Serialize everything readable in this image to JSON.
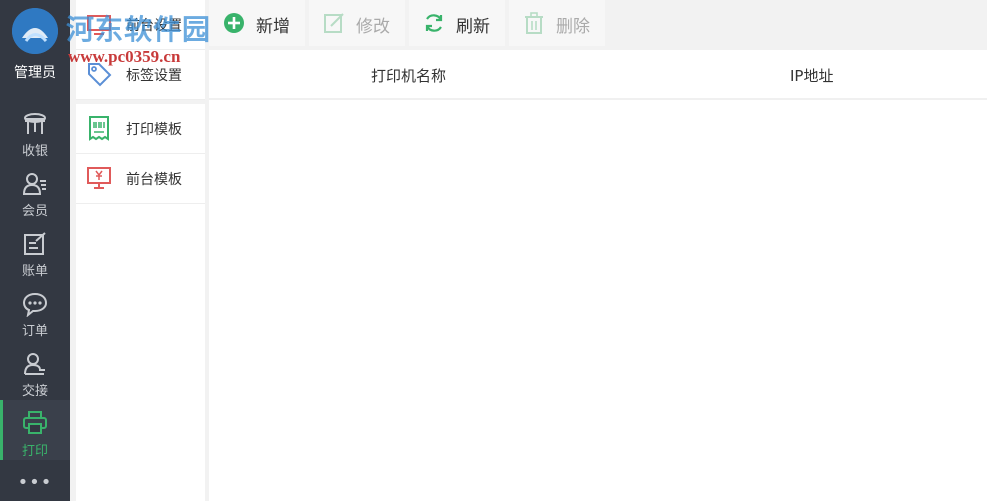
{
  "watermark": {
    "site_name": "河东软件园",
    "url": "www.pc0359.cn"
  },
  "user": {
    "label": "管理员"
  },
  "nav": {
    "items": [
      {
        "id": "cashier",
        "label": "收银",
        "icon": "stool-icon"
      },
      {
        "id": "member",
        "label": "会员",
        "icon": "member-icon"
      },
      {
        "id": "bill",
        "label": "账单",
        "icon": "edit-note-icon"
      },
      {
        "id": "order",
        "label": "订单",
        "icon": "chat-bubble-icon"
      },
      {
        "id": "handover",
        "label": "交接",
        "icon": "user-handover-icon"
      },
      {
        "id": "print",
        "label": "打印",
        "icon": "printer-icon",
        "active": true
      }
    ],
    "more": "•••",
    "active_color": "#39b36b"
  },
  "submenu": {
    "items": [
      {
        "id": "front-settings",
        "label": "前台设置",
        "icon": "front-desk-icon"
      },
      {
        "id": "label-settings",
        "label": "标签设置",
        "icon": "tag-icon"
      },
      {
        "id": "print-template",
        "label": "打印模板",
        "icon": "receipt-icon"
      },
      {
        "id": "front-template",
        "label": "前台模板",
        "icon": "monitor-yuan-icon"
      }
    ]
  },
  "toolbar": {
    "add": "新增",
    "edit": "修改",
    "refresh": "刷新",
    "delete": "删除"
  },
  "table": {
    "columns": [
      "打印机名称",
      "IP地址"
    ],
    "rows": []
  }
}
